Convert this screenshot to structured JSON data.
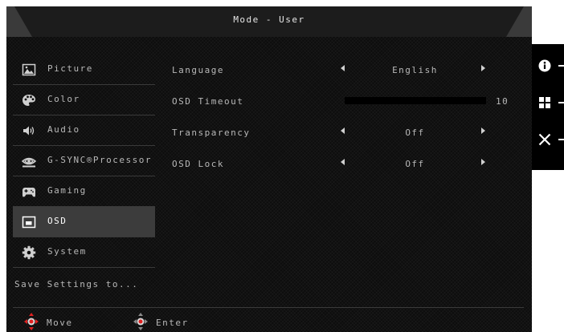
{
  "title": "Mode - User",
  "sidebar": {
    "items": [
      {
        "label": "Picture",
        "icon": "picture-icon",
        "active": false
      },
      {
        "label": "Color",
        "icon": "palette-icon",
        "active": false
      },
      {
        "label": "Audio",
        "icon": "speaker-icon",
        "active": false
      },
      {
        "label": "G-SYNC®Processor",
        "icon": "nvidia-icon",
        "active": false
      },
      {
        "label": "Gaming",
        "icon": "gamepad-icon",
        "active": false
      },
      {
        "label": "OSD",
        "icon": "osd-icon",
        "active": true
      },
      {
        "label": "System",
        "icon": "gear-icon",
        "active": false
      }
    ],
    "save_label": "Save Settings to..."
  },
  "settings": {
    "language": {
      "label": "Language",
      "value": "English"
    },
    "osd_timeout": {
      "label": "OSD Timeout",
      "value": "10",
      "fraction": 0.0
    },
    "transparency": {
      "label": "Transparency",
      "value": "Off"
    },
    "osd_lock": {
      "label": "OSD Lock",
      "value": "Off"
    }
  },
  "footer": {
    "move_label": "Move",
    "enter_label": "Enter"
  },
  "keys": [
    "info-icon",
    "grid-icon",
    "close-icon"
  ],
  "colors": {
    "background": "#0d0d0d",
    "active_row": "#3c3c3c",
    "text": "#b8b8b8",
    "joystick_accent": "#e02020"
  }
}
